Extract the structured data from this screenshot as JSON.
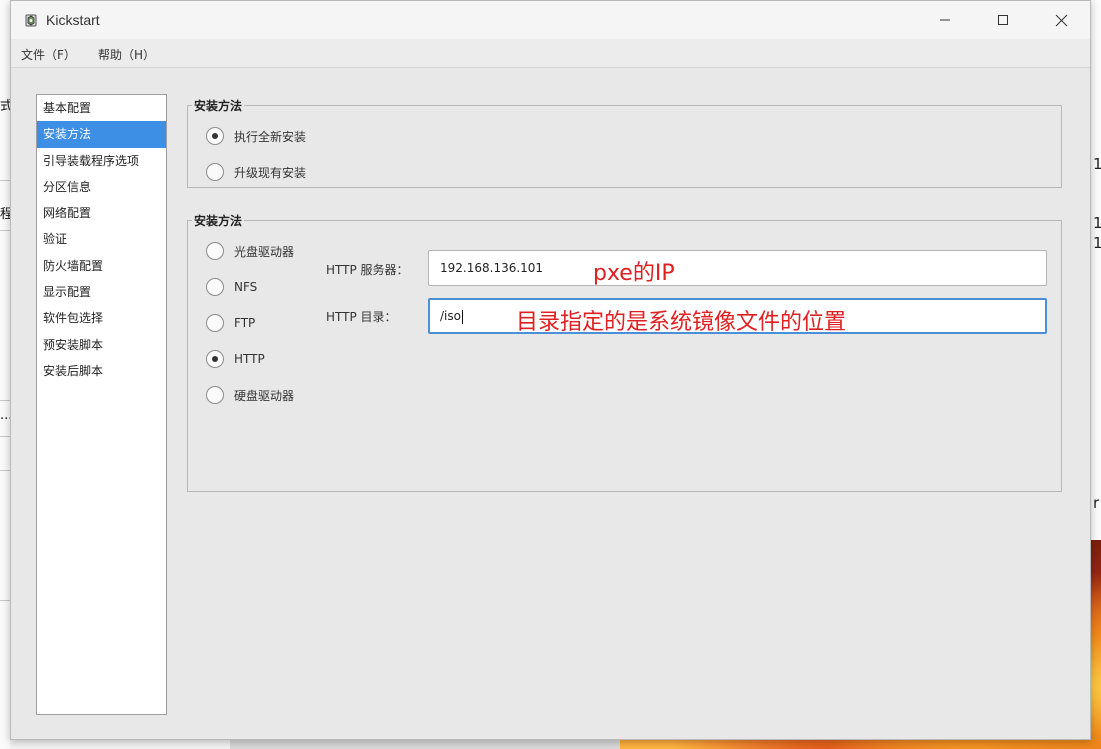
{
  "background": {
    "left_glyphs": [
      "式",
      "程",
      "..."
    ],
    "right_glyphs": [
      "1",
      "1",
      "1",
      "r"
    ]
  },
  "window": {
    "title": "Kickstart",
    "controls": {
      "minimize": "—",
      "maximize": "☐",
      "close": "✕"
    }
  },
  "menubar": {
    "items": [
      "文件（F）",
      "帮助（H）"
    ]
  },
  "sidebar": {
    "items": [
      {
        "label": "基本配置",
        "selected": false
      },
      {
        "label": "安装方法",
        "selected": true
      },
      {
        "label": "引导装载程序选项",
        "selected": false
      },
      {
        "label": "分区信息",
        "selected": false
      },
      {
        "label": "网络配置",
        "selected": false
      },
      {
        "label": "验证",
        "selected": false
      },
      {
        "label": "防火墙配置",
        "selected": false
      },
      {
        "label": "显示配置",
        "selected": false
      },
      {
        "label": "软件包选择",
        "selected": false
      },
      {
        "label": "预安装脚本",
        "selected": false
      },
      {
        "label": "安装后脚本",
        "selected": false
      }
    ]
  },
  "install_type": {
    "title": "安装方法",
    "options": [
      {
        "label": "执行全新安装",
        "checked": true
      },
      {
        "label": "升级现有安装",
        "checked": false
      }
    ]
  },
  "install_source": {
    "title": "安装方法",
    "options": [
      {
        "label": "光盘驱动器",
        "checked": false
      },
      {
        "label": "NFS",
        "checked": false
      },
      {
        "label": "FTP",
        "checked": false
      },
      {
        "label": "HTTP",
        "checked": true
      },
      {
        "label": "硬盘驱动器",
        "checked": false
      }
    ],
    "http_server_label": "HTTP 服务器：",
    "http_server_value": "192.168.136.101",
    "http_dir_label": "HTTP 目录：",
    "http_dir_value": "/iso"
  },
  "annotations": {
    "server_note": "pxe的IP",
    "dir_note": "目录指定的是系统镜像文件的位置"
  },
  "colors": {
    "selection": "#3d8ee5",
    "annotation": "#e02020",
    "focus_border": "#4a90d9"
  }
}
